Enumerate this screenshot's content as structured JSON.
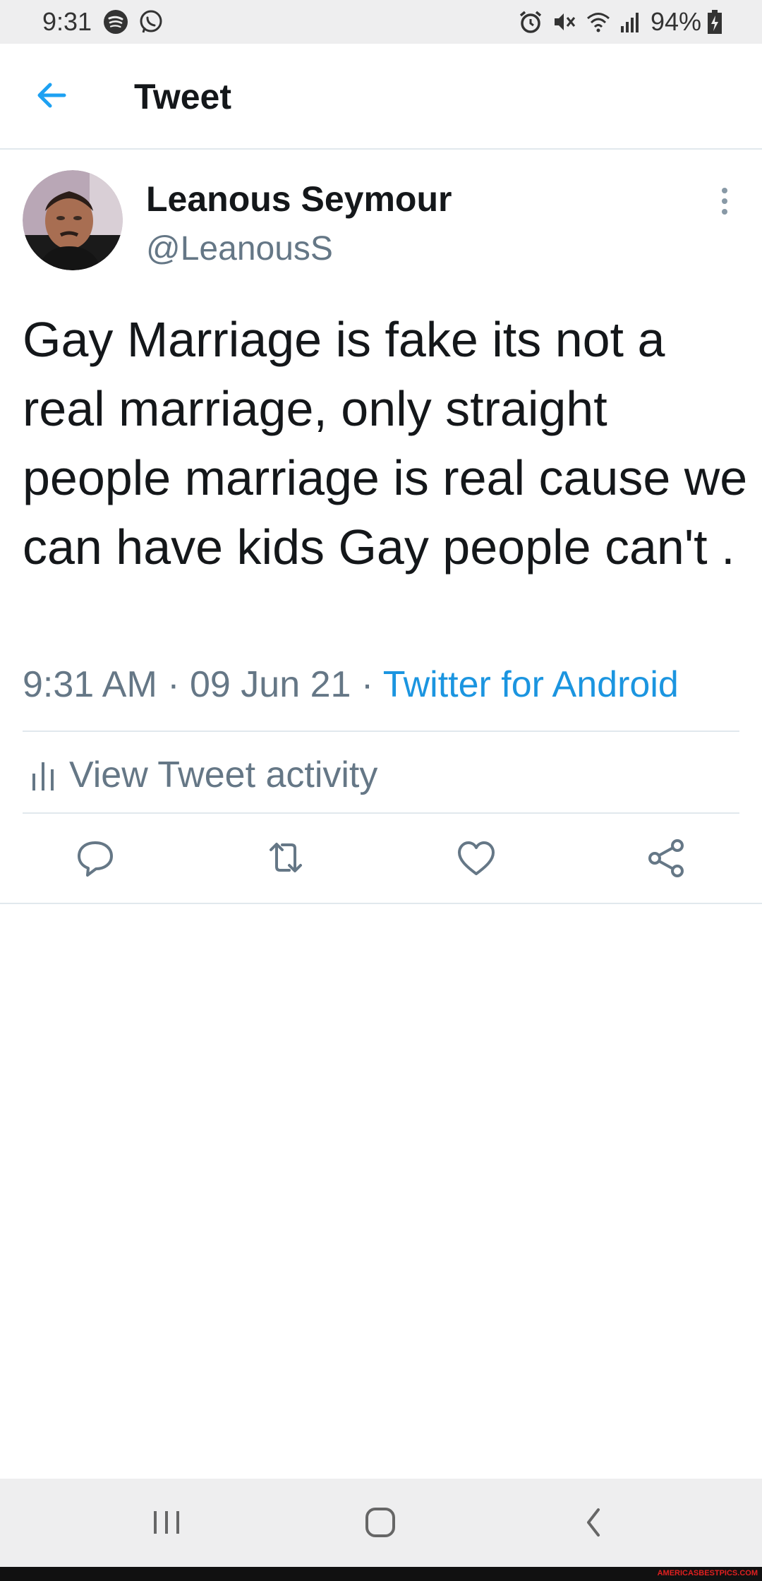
{
  "status_bar": {
    "time": "9:31",
    "battery": "94%",
    "icons": [
      "spotify-icon",
      "whatsapp-icon",
      "alarm-icon",
      "mute-icon",
      "wifi-icon",
      "signal-icon",
      "battery-icon"
    ]
  },
  "app_bar": {
    "title": "Tweet",
    "back_icon": "arrow-left-icon"
  },
  "tweet": {
    "author_name": "Leanous Seymour",
    "author_handle": "@LeanousS",
    "text": "Gay Marriage is fake its not a real marriage, only straight people marriage is real cause we can have kids Gay people can't .",
    "time": "9:31 AM",
    "separator": " · ",
    "date": "09 Jun 21",
    "source": "Twitter for Android",
    "activity_label": "View Tweet activity"
  },
  "actions": [
    "reply-icon",
    "retweet-icon",
    "like-icon",
    "share-icon"
  ],
  "colors": {
    "accent": "#1da1f2",
    "link": "#1b95e0",
    "text": "#14171a",
    "secondary": "#657786",
    "divider": "#e1e8ed",
    "system_bar": "#eeeeef"
  },
  "watermark": "AMERICASBESTPICS.COM"
}
